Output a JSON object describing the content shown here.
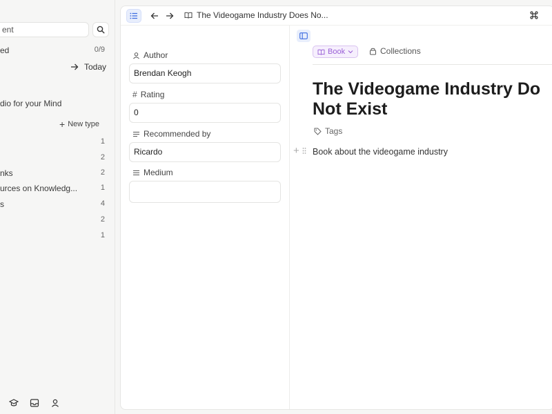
{
  "sidebar": {
    "search_value": "ent",
    "rows": [
      {
        "label": "ed",
        "count": "0/9"
      },
      {
        "label": "dio for your Mind",
        "count": ""
      },
      {
        "label": "",
        "count": "1"
      },
      {
        "label": "",
        "count": "2"
      },
      {
        "label": "nks",
        "count": "2"
      },
      {
        "label": "urces on Knowledg...",
        "count": "1"
      },
      {
        "label": "s",
        "count": "4"
      },
      {
        "label": "",
        "count": "2"
      },
      {
        "label": "",
        "count": "1"
      }
    ],
    "today_label": "Today",
    "new_type_label": "New type"
  },
  "topbar": {
    "breadcrumb_title": "The Videogame Industry Does No..."
  },
  "properties": {
    "author_label": "Author",
    "author_value": "Brendan Keogh",
    "rating_label": "Rating",
    "rating_value": "0",
    "recommended_label": "Recommended by",
    "recommended_value": "Ricardo",
    "medium_label": "Medium",
    "medium_value": ""
  },
  "document": {
    "type_chip": "Book",
    "collections_label": "Collections",
    "title_line1": "The Videogame Industry Do",
    "title_line2": "Not Exist",
    "tags_label": "Tags",
    "body_text": "Book about the videogame industry"
  },
  "colors": {
    "accent": "#3c6be0",
    "type_chip": "#9a5fd6"
  }
}
